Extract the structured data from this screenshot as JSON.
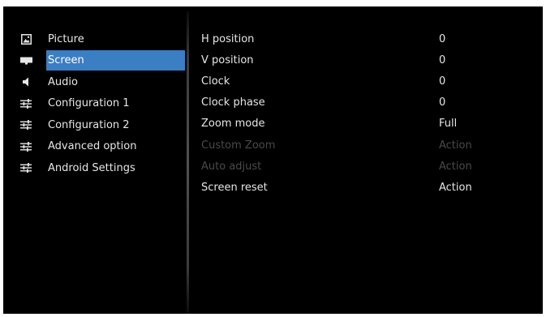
{
  "sidebar": {
    "items": [
      {
        "label": "Picture",
        "icon": "picture-icon"
      },
      {
        "label": "Screen",
        "icon": "screen-icon",
        "selected": true
      },
      {
        "label": "Audio",
        "icon": "speaker-icon"
      },
      {
        "label": "Configuration 1",
        "icon": "sliders-icon"
      },
      {
        "label": "Configuration 2",
        "icon": "sliders-icon"
      },
      {
        "label": "Advanced option",
        "icon": "sliders-icon"
      },
      {
        "label": "Android Settings",
        "icon": "sliders-icon"
      }
    ]
  },
  "settings": {
    "rows": [
      {
        "name": "H position",
        "value": "0",
        "enabled": true
      },
      {
        "name": "V position",
        "value": "0",
        "enabled": true
      },
      {
        "name": "Clock",
        "value": "0",
        "enabled": true
      },
      {
        "name": "Clock phase",
        "value": "0",
        "enabled": true
      },
      {
        "name": "Zoom mode",
        "value": "Full",
        "enabled": true
      },
      {
        "name": "Custom Zoom",
        "value": "Action",
        "enabled": false
      },
      {
        "name": "Auto adjust",
        "value": "Action",
        "enabled": false
      },
      {
        "name": "Screen reset",
        "value": "Action",
        "enabled": true
      }
    ]
  },
  "colors": {
    "background": "#000000",
    "selected": "#3a7ec4",
    "text": "#e6e6e6",
    "disabled_text": "#4a4a4a"
  }
}
